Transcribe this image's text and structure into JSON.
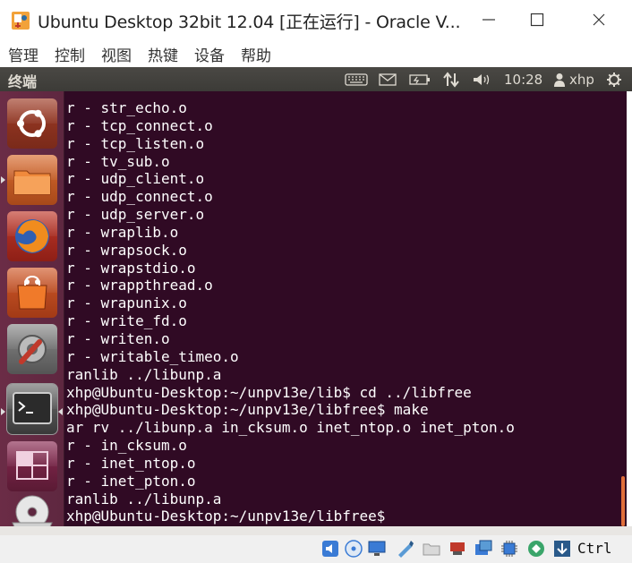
{
  "window": {
    "title": "Ubuntu Desktop 32bit 12.04 [正在运行] - Oracle V...",
    "minimize_symbol": "—",
    "maximize_symbol": "☐",
    "close_symbol": "✕"
  },
  "menubar": {
    "items": [
      "管理",
      "控制",
      "视图",
      "热键",
      "设备",
      "帮助"
    ]
  },
  "panel": {
    "title": "终端",
    "time": "10:28",
    "user": "xhp",
    "icons": [
      "keyboard-icon",
      "mail-icon",
      "battery-icon",
      "network-icon",
      "volume-icon",
      "user-icon",
      "gear-icon"
    ]
  },
  "launcher": {
    "items": [
      {
        "name": "ubuntu-dash",
        "icon": "ubuntu-logo-icon"
      },
      {
        "name": "files",
        "icon": "folder-icon"
      },
      {
        "name": "firefox",
        "icon": "firefox-icon"
      },
      {
        "name": "software-center",
        "icon": "shopping-bag-icon"
      },
      {
        "name": "system-settings",
        "icon": "settings-icon"
      },
      {
        "name": "terminal",
        "icon": "terminal-icon",
        "active": true
      },
      {
        "name": "workspace-switcher",
        "icon": "workspace-icon"
      },
      {
        "name": "dvd",
        "icon": "disc-icon"
      }
    ]
  },
  "terminal": {
    "lines": [
      "r - str_echo.o",
      "r - tcp_connect.o",
      "r - tcp_listen.o",
      "r - tv_sub.o",
      "r - udp_client.o",
      "r - udp_connect.o",
      "r - udp_server.o",
      "r - wraplib.o",
      "r - wrapsock.o",
      "r - wrapstdio.o",
      "r - wrappthread.o",
      "r - wrapunix.o",
      "r - write_fd.o",
      "r - writen.o",
      "r - writable_timeo.o",
      "ranlib ../libunp.a",
      "xhp@Ubuntu-Desktop:~/unpv13e/lib$ cd ../libfree",
      "xhp@Ubuntu-Desktop:~/unpv13e/libfree$ make",
      "ar rv ../libunp.a in_cksum.o inet_ntop.o inet_pton.o",
      "r - in_cksum.o",
      "r - inet_ntop.o",
      "r - inet_pton.o",
      "ranlib ../libunp.a",
      "xhp@Ubuntu-Desktop:~/unpv13e/libfree$ "
    ]
  },
  "statusbar": {
    "host_key": "Ctrl",
    "icons": [
      "audio-icon",
      "optical-drive-icon",
      "display-icon",
      "usb-pen-icon",
      "shared-folder-icon",
      "network-adapter-icon",
      "screen-capture-icon",
      "cpu-icon",
      "mouse-integration-icon",
      "arrow-down-icon"
    ]
  },
  "colors": {
    "terminal_bg": "#300a24",
    "launcher_bg": "#6b2c46",
    "panel_bg": "#3c3b37"
  }
}
